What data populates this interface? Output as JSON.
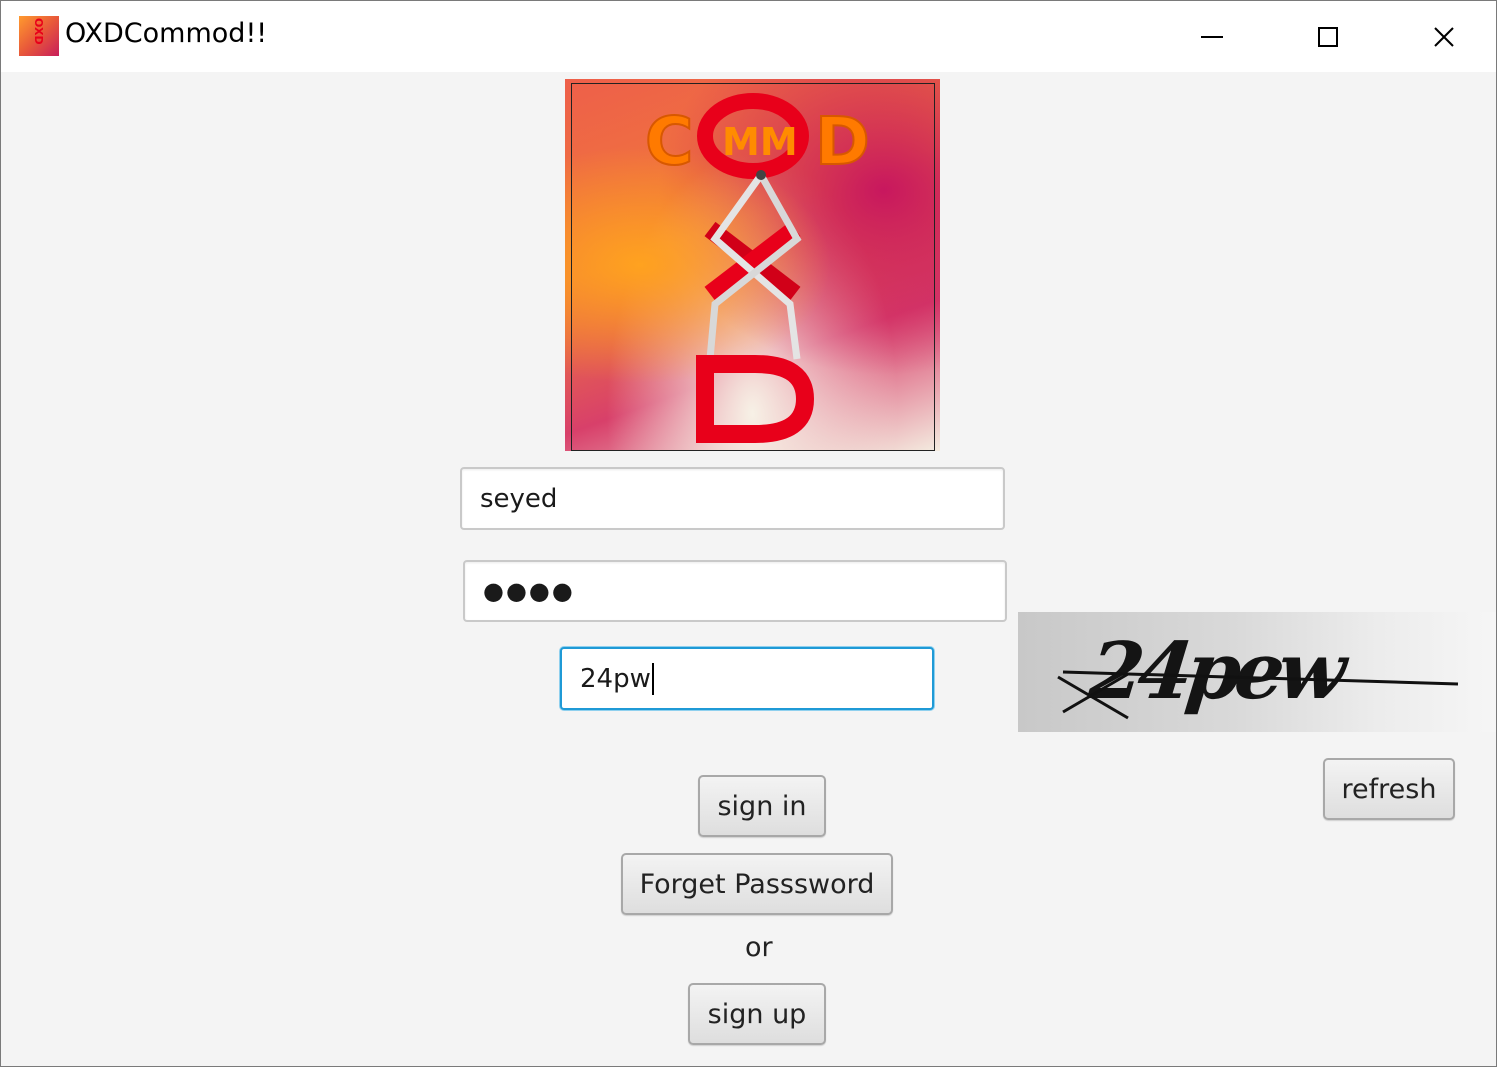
{
  "window": {
    "title": "OXDCommod!!",
    "icon_text": "OXD",
    "controls": [
      "minimize",
      "maximize",
      "close"
    ]
  },
  "logo": {
    "text": "COMMOD OXD"
  },
  "form": {
    "username": {
      "value": "seyed"
    },
    "password": {
      "masked_value": "●●●●"
    },
    "captcha_input": {
      "value": "24pw"
    },
    "captcha_image_text": "24pew"
  },
  "buttons": {
    "sign_in": "sign in",
    "forget_password": "Forget Passsword",
    "or_label": "or",
    "sign_up": "sign up",
    "refresh": "refresh"
  },
  "colors": {
    "background": "#f4f4f4",
    "focus_border": "#1f9ad6",
    "logo_red": "#e8001a",
    "logo_orange": "#ff7a00"
  }
}
